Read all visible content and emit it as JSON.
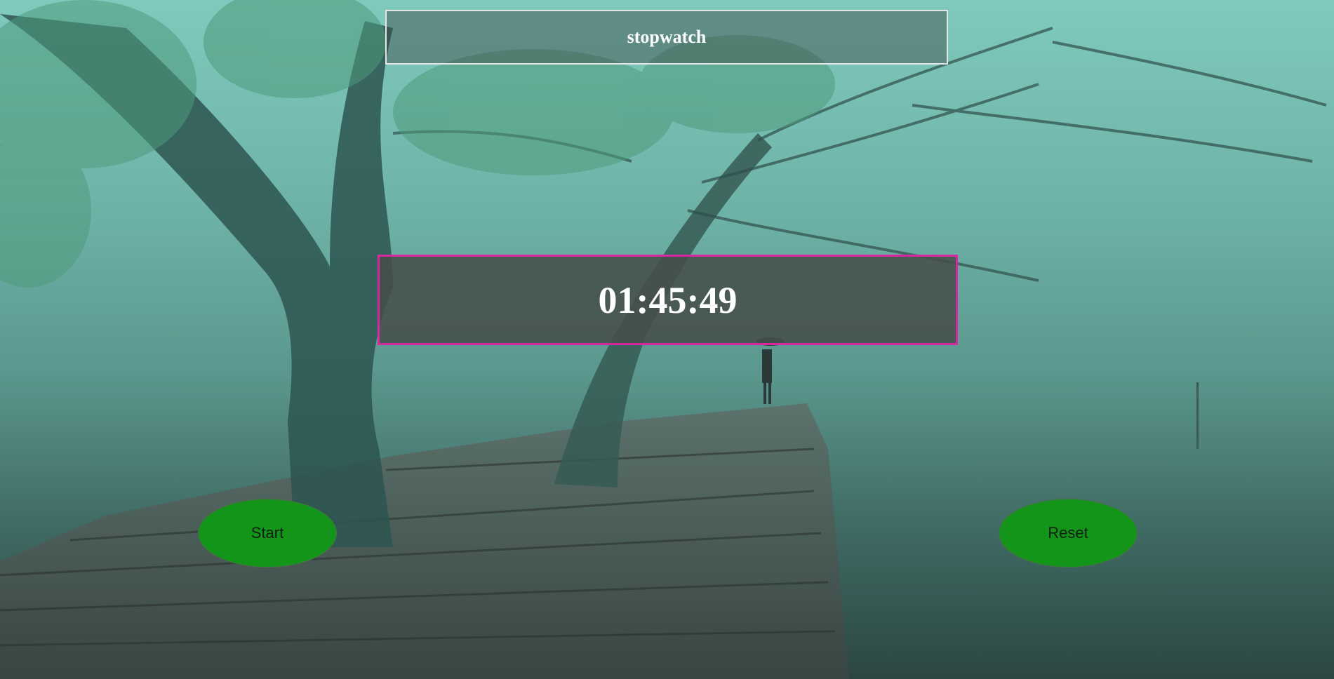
{
  "header": {
    "title": "stopwatch"
  },
  "display": {
    "time": "01:45:49"
  },
  "controls": {
    "start_label": "Start",
    "reset_label": "Reset"
  },
  "colors": {
    "button_fill": "#13951a",
    "display_border": "#d9279f",
    "title_border": "#e6e6e6",
    "text": "#ffffff"
  }
}
